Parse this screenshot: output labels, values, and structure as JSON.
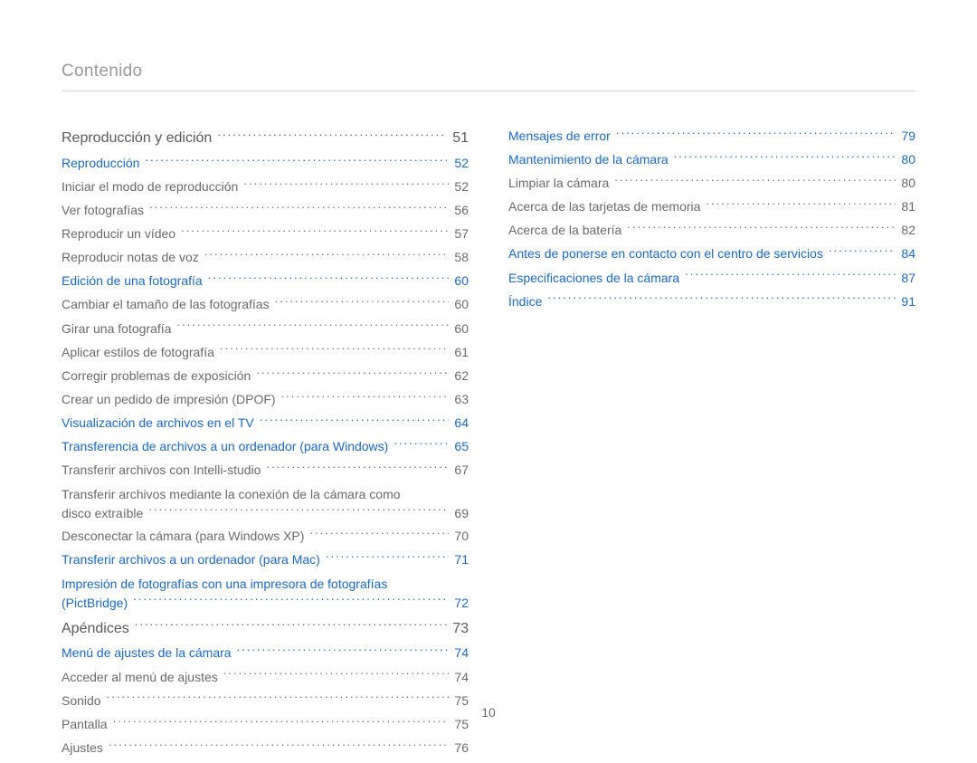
{
  "header": {
    "title": "Contenido"
  },
  "footer": {
    "page": "10"
  },
  "col1": {
    "items": [
      {
        "label": "Reproducción y edición",
        "page": "51",
        "style": "head"
      },
      {
        "label": "Reproducción",
        "page": "52",
        "style": "link"
      },
      {
        "label": "Iniciar el modo de reproducción",
        "page": "52",
        "style": "plain"
      },
      {
        "label": "Ver fotografías",
        "page": "56",
        "style": "plain"
      },
      {
        "label": "Reproducir un vídeo",
        "page": "57",
        "style": "plain"
      },
      {
        "label": "Reproducir notas de voz",
        "page": "58",
        "style": "plain"
      },
      {
        "label": "Edición de una fotografía",
        "page": "60",
        "style": "link"
      },
      {
        "label": "Cambiar el tamaño de las fotografías",
        "page": "60",
        "style": "plain"
      },
      {
        "label": "Girar una fotografía",
        "page": "60",
        "style": "plain"
      },
      {
        "label": "Aplicar estilos de fotografía",
        "page": "61",
        "style": "plain"
      },
      {
        "label": "Corregir problemas de exposición",
        "page": "62",
        "style": "plain"
      },
      {
        "label": "Crear un pedido de impresión (DPOF)",
        "page": "63",
        "style": "plain"
      },
      {
        "label": "Visualización de archivos en el TV",
        "page": "64",
        "style": "link"
      },
      {
        "label": "Transferencia de archivos a un ordenador (para Windows)",
        "page": "65",
        "style": "link"
      },
      {
        "label": "Transferir archivos con Intelli-studio",
        "page": "67",
        "style": "plain"
      },
      {
        "wrap": true,
        "line1": "Transferir archivos mediante la conexión de la cámara como",
        "line2": "disco extraíble",
        "page": "69",
        "style": "plain"
      },
      {
        "label": "Desconectar la cámara (para Windows XP)",
        "page": "70",
        "style": "plain"
      },
      {
        "label": "Transferir archivos a un ordenador (para Mac)",
        "page": "71",
        "style": "link"
      },
      {
        "wrap": true,
        "line1": "Impresión de fotografías con una impresora de fotografías",
        "line2": "(PictBridge)",
        "page": "72",
        "style": "link"
      },
      {
        "label": "Apéndices",
        "page": "73",
        "style": "head",
        "gap": true
      },
      {
        "label": "Menú de ajustes de la cámara",
        "page": "74",
        "style": "link"
      },
      {
        "label": "Acceder al menú de ajustes",
        "page": "74",
        "style": "plain"
      },
      {
        "label": "Sonido",
        "page": "75",
        "style": "plain"
      },
      {
        "label": "Pantalla",
        "page": "75",
        "style": "plain"
      },
      {
        "label": "Ajustes",
        "page": "76",
        "style": "plain"
      }
    ]
  },
  "col2": {
    "items": [
      {
        "label": "Mensajes de error",
        "page": "79",
        "style": "link"
      },
      {
        "label": "Mantenimiento de la cámara",
        "page": "80",
        "style": "link"
      },
      {
        "label": "Limpiar la cámara",
        "page": "80",
        "style": "plain"
      },
      {
        "label": "Acerca de las tarjetas de memoria",
        "page": "81",
        "style": "plain"
      },
      {
        "label": "Acerca de la batería",
        "page": "82",
        "style": "plain"
      },
      {
        "label": "Antes de ponerse en contacto con el centro de servicios",
        "page": "84",
        "style": "link"
      },
      {
        "label": "Especificaciones de la cámara",
        "page": "87",
        "style": "link"
      },
      {
        "label": "Índice",
        "page": "91",
        "style": "link"
      }
    ]
  }
}
